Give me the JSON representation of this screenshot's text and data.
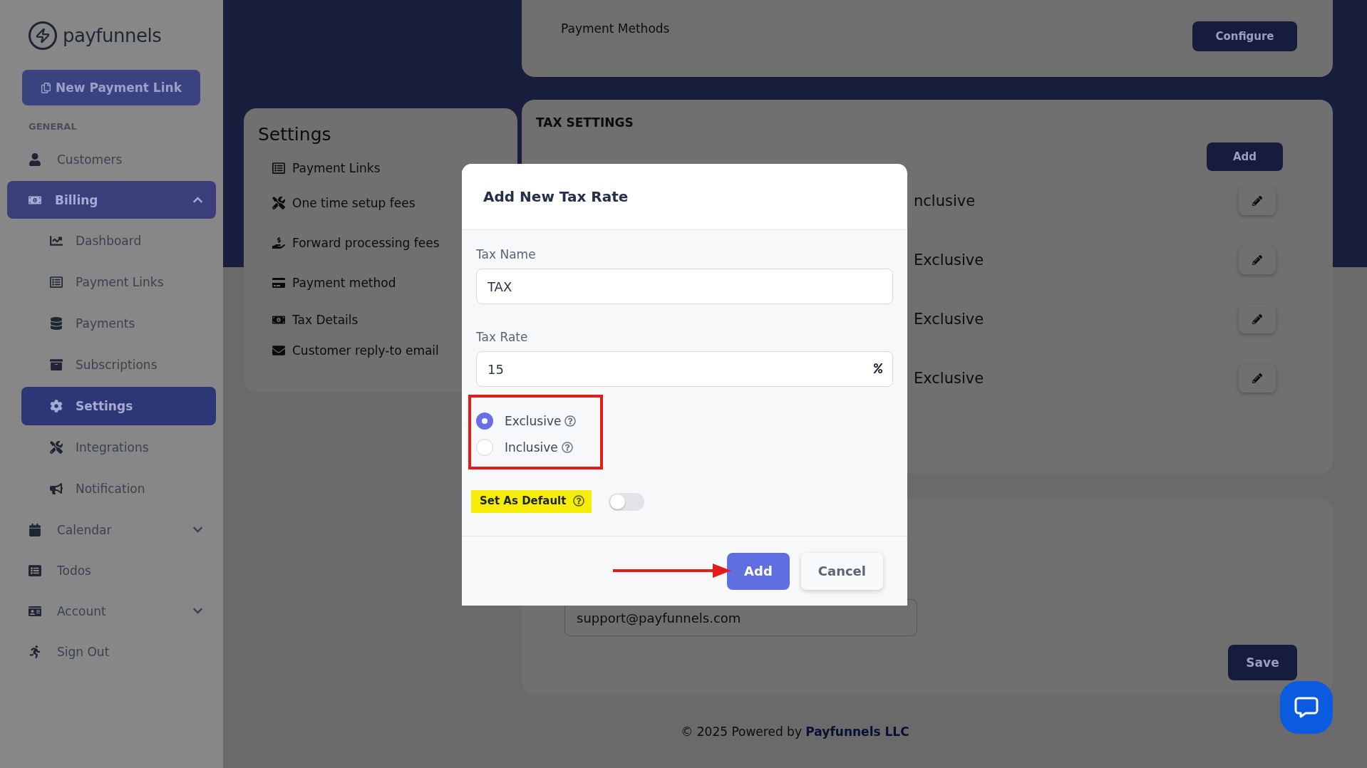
{
  "sidebar": {
    "logo": "payfunnels",
    "new_button": "New Payment Link",
    "section": "GENERAL",
    "items": [
      {
        "label": "Customers",
        "selected": false
      },
      {
        "label": "Billing",
        "selected": true,
        "expanded": true,
        "children": [
          {
            "label": "Dashboard",
            "selected": false
          },
          {
            "label": "Payment Links",
            "selected": false
          },
          {
            "label": "Payments",
            "selected": false
          },
          {
            "label": "Subscriptions",
            "selected": false
          },
          {
            "label": "Settings",
            "selected": true
          },
          {
            "label": "Integrations",
            "selected": false
          },
          {
            "label": "Notification",
            "selected": false
          }
        ]
      },
      {
        "label": "Calendar",
        "selected": false,
        "expanded": false
      },
      {
        "label": "Todos",
        "selected": false
      },
      {
        "label": "Account",
        "selected": false,
        "expanded": false
      },
      {
        "label": "Sign Out",
        "selected": false
      }
    ]
  },
  "top_card": {
    "label": "Payment Methods",
    "button": "Configure"
  },
  "settings_menu": {
    "title": "Settings",
    "items": [
      "Payment Links",
      "One time setup fees",
      "Forward processing fees",
      "Payment method",
      "Tax Details",
      "Customer reply-to email"
    ]
  },
  "tax_settings": {
    "title": "TAX SETTINGS",
    "add_button": "Add",
    "rows": [
      {
        "text": "nclusive"
      },
      {
        "text": "Exclusive"
      },
      {
        "text": "Exclusive"
      },
      {
        "text": "Exclusive"
      }
    ]
  },
  "email_card": {
    "email": "support@payfunnels.com",
    "save_button": "Save"
  },
  "footer": {
    "text": "© 2025 Powered by",
    "link": "Payfunnels LLC"
  },
  "modal": {
    "title": "Add New Tax Rate",
    "fields": [
      {
        "label": "Tax Name",
        "value": "TAX",
        "kind": "text"
      },
      {
        "label": "Tax Rate",
        "value": "15",
        "kind": "percent"
      }
    ],
    "options": [
      {
        "label": "Exclusive",
        "selected": true
      },
      {
        "label": "Inclusive",
        "selected": false
      }
    ],
    "default_toggle": {
      "label": "Set As Default",
      "on": false
    },
    "buttons": [
      {
        "label": "Add",
        "kind": "primary"
      },
      {
        "label": "Cancel",
        "kind": "secondary"
      }
    ]
  }
}
